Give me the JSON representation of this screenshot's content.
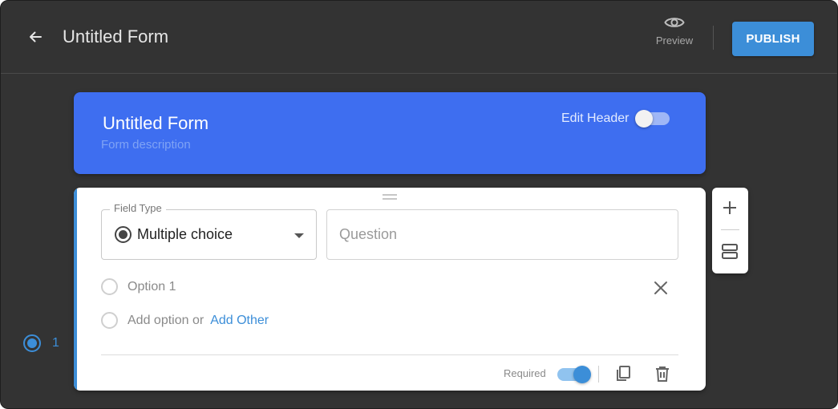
{
  "app": {
    "title": "Untitled Form",
    "preview_label": "Preview",
    "publish_label": "PUBLISH"
  },
  "header": {
    "title": "Untitled Form",
    "description_placeholder": "Form description",
    "edit_header_label": "Edit Header",
    "edit_header_enabled": false
  },
  "question": {
    "field_type_label": "Field Type",
    "field_type_value": "Multiple choice",
    "question_placeholder": "Question",
    "options": [
      "Option 1"
    ],
    "add_option_label": "Add option or",
    "add_other_label": "Add Other",
    "required_label": "Required",
    "required_enabled": true
  },
  "navigator": {
    "current_question": "1"
  },
  "colors": {
    "background": "#333333",
    "header_blue": "#3e6ef0",
    "accent": "#3c8ed8"
  },
  "icons": {
    "back": "arrow-left-icon",
    "preview": "eye-icon",
    "drag": "drag-handle-icon",
    "remove": "close-icon",
    "copy": "copy-icon",
    "delete": "trash-icon",
    "add": "plus-icon",
    "section": "section-icon"
  }
}
